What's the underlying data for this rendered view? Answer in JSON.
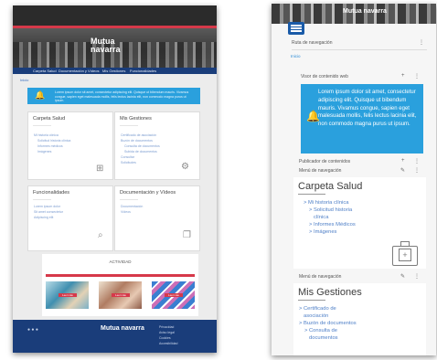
{
  "desktop": {
    "logo": "Mutua navarra",
    "nav_items": [
      "Carpeta Salud",
      "Documentación y Vídeos",
      "Mis Gestiones",
      "Funcionalidades"
    ],
    "info_text": "Lorem ipsum dolor sit amet, consectetur adipiscing elit. Quisque ut bibendum mauris. Vivamus congue, sapien eget malesuada mollis, felis lectus lacinia elit, non commodo magna purus ut ipsum.",
    "cards": [
      {
        "title": "Carpeta Salud",
        "items": [
          "Mi historia clínica",
          "Solicitud historia clínica",
          "Informes médicos",
          "Imágenes"
        ]
      },
      {
        "title": "Mis Gestiones",
        "items": [
          "Certificado de asociación",
          "Buzón de documentos",
          "Consulta de documentos",
          "Subida de documentos",
          "Consultar",
          "Solicitudes"
        ]
      },
      {
        "title": "Funcionalidades",
        "items": [
          "Lorem ipsum dolor",
          "Sit amet consectetur",
          "Adipiscing elit"
        ]
      },
      {
        "title": "Documentación y Vídeos",
        "items": [
          "Documentación",
          "Vídeos"
        ]
      }
    ],
    "activity_title": "ACTIVIDAD",
    "activity_buttons": [
      "Leer más",
      "Leer más",
      "Leer más"
    ],
    "footer_items": [
      "Privacidad",
      "Aviso legal",
      "Cookies",
      "Accesibilidad"
    ]
  },
  "mobile": {
    "logo": "Mutua navarra",
    "rows": {
      "breadcrumb": "Ruta de navegación",
      "inicio": "Inicio",
      "web_content": "Visor de contenido web",
      "content_publisher": "Publicador de contenidos",
      "nav_menu_1": "Menú de navegación",
      "nav_menu_2": "Menú de navegación"
    },
    "controls": {
      "add": "+",
      "more": "⋮",
      "edit": "✎"
    },
    "blue_text": "Lorem ipsum dolor sit amet, consectetur adipiscing elit. Quisque ut bibendum mauris. Vivamus congue, sapien eget malesuada mollis, felis lectus lacinia elit, non commodo magna purus ut ipsum.",
    "carpeta": {
      "title": "Carpeta Salud",
      "links": [
        "> Mi historia clínica",
        "> Solicitud historia",
        "clínica",
        "> Informes Médicos",
        "> Imágenes"
      ]
    },
    "gestiones": {
      "title": "Mis Gestiones",
      "links": [
        "> Certificado de",
        "asociación",
        "> Buzón de documentos",
        "> Consulta de",
        "documentos"
      ]
    }
  },
  "colors": {
    "brand_blue": "#1a3d7a",
    "info_blue": "#2aa0dd",
    "accent_red": "#d6394a"
  }
}
